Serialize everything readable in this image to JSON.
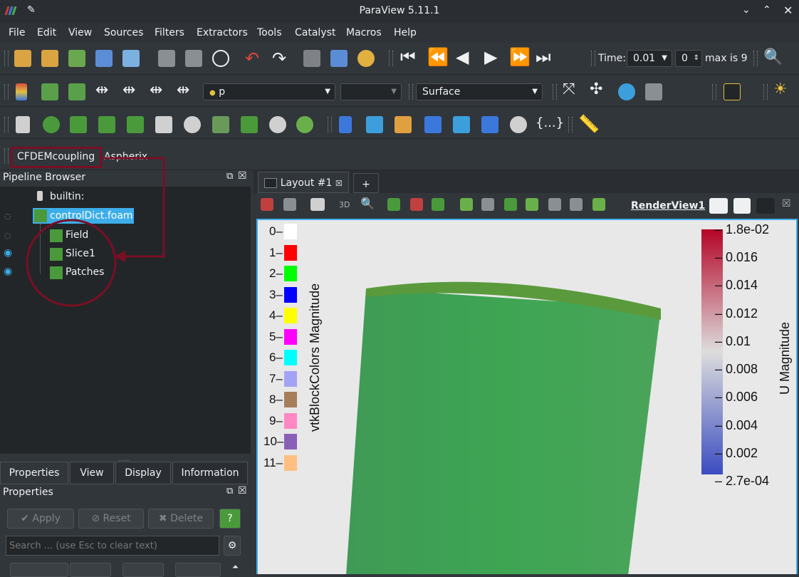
{
  "app": {
    "title": "ParaView 5.11.1"
  },
  "menu": [
    "File",
    "Edit",
    "View",
    "Sources",
    "Filters",
    "Extractors",
    "Tools",
    "Catalyst",
    "Macros",
    "Help"
  ],
  "time": {
    "label": "Time:",
    "value": "0.01",
    "index": "0",
    "max_label": "max is 9"
  },
  "toolbar2": {
    "array_value": "p",
    "representation": "Surface"
  },
  "plugin_toolbar": {
    "cfdem": "CFDEMcoupling",
    "aspherix": "Aspherix"
  },
  "pipeline": {
    "header": "Pipeline Browser",
    "items": [
      {
        "label": "builtin:"
      },
      {
        "label": "controlDict.foam"
      },
      {
        "label": "Field"
      },
      {
        "label": "Slice1"
      },
      {
        "label": "Patches"
      }
    ]
  },
  "props_tabs": [
    "Properties",
    "View",
    "Display",
    "Information"
  ],
  "properties": {
    "header": "Properties",
    "apply": "Apply",
    "reset": "Reset",
    "delete": "Delete",
    "help": "?",
    "search_placeholder": "Search ... (use Esc to clear text)"
  },
  "layout": {
    "tab": "Layout #1",
    "add": "+",
    "render_view": "RenderView1",
    "mode_3d": "3D"
  },
  "block_legend": {
    "title": "vtkBlockColors Magnitude",
    "entries": [
      {
        "label": "0",
        "color": "#ffffff"
      },
      {
        "label": "1",
        "color": "#ff0000"
      },
      {
        "label": "2",
        "color": "#00ff00"
      },
      {
        "label": "3",
        "color": "#0000ff"
      },
      {
        "label": "4",
        "color": "#ffff00"
      },
      {
        "label": "5",
        "color": "#ff00ff"
      },
      {
        "label": "6",
        "color": "#00ffff"
      },
      {
        "label": "7",
        "color": "#a3a3f5"
      },
      {
        "label": "8",
        "color": "#a67e5a"
      },
      {
        "label": "9",
        "color": "#ff87c4"
      },
      {
        "label": "10",
        "color": "#8a5fb8"
      },
      {
        "label": "11",
        "color": "#ffbf80"
      }
    ]
  },
  "color_bar": {
    "title": "U Magnitude",
    "ticks": [
      "1.8e-02",
      "0.016",
      "0.014",
      "0.012",
      "0.01",
      "0.008",
      "0.006",
      "0.004",
      "0.002",
      "2.7e-04"
    ],
    "colors": {
      "high": "#b40426",
      "mid": "#dddddd",
      "low": "#3b4cc0"
    }
  },
  "accent": "#7a0f24"
}
